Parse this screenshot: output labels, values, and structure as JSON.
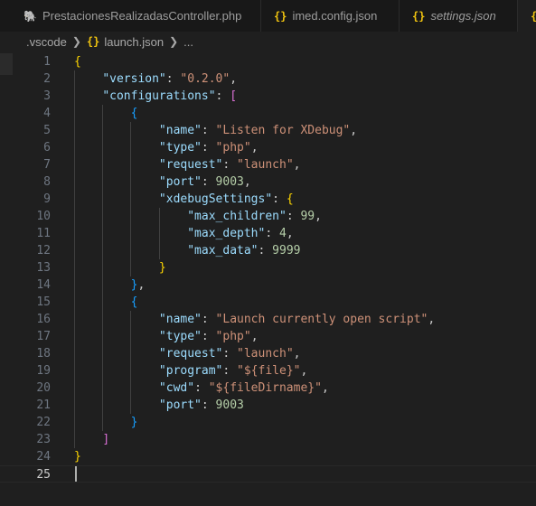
{
  "tabs": [
    {
      "icon": "php-icon",
      "glyph": "🐘",
      "label": "PrestacionesRealizadasController.php",
      "italic": false
    },
    {
      "icon": "json-icon",
      "glyph": "{}",
      "label": "imed.config.json",
      "italic": false
    },
    {
      "icon": "json-icon",
      "glyph": "{}",
      "label": "settings.json",
      "italic": true
    },
    {
      "icon": "json-icon",
      "glyph": "{",
      "label": "",
      "italic": false
    }
  ],
  "breadcrumb": {
    "folder": ".vscode",
    "file_icon": "{}",
    "file": "launch.json",
    "more": "..."
  },
  "editor": {
    "current_line": 25,
    "lines": [
      {
        "n": "1",
        "tokens": [
          [
            "{",
            "b1"
          ]
        ]
      },
      {
        "n": "2",
        "tokens": [
          [
            "    ",
            "t-pun"
          ],
          [
            "\"version\"",
            "t-key"
          ],
          [
            ": ",
            "t-pun"
          ],
          [
            "\"0.2.0\"",
            "t-str"
          ],
          [
            ",",
            "t-pun"
          ]
        ]
      },
      {
        "n": "3",
        "tokens": [
          [
            "    ",
            "t-pun"
          ],
          [
            "\"configurations\"",
            "t-key"
          ],
          [
            ": ",
            "t-pun"
          ],
          [
            "[",
            "b2"
          ]
        ]
      },
      {
        "n": "4",
        "tokens": [
          [
            "        ",
            "t-pun"
          ],
          [
            "{",
            "b3"
          ]
        ]
      },
      {
        "n": "5",
        "tokens": [
          [
            "            ",
            "t-pun"
          ],
          [
            "\"name\"",
            "t-key"
          ],
          [
            ": ",
            "t-pun"
          ],
          [
            "\"Listen for XDebug\"",
            "t-str"
          ],
          [
            ",",
            "t-pun"
          ]
        ]
      },
      {
        "n": "6",
        "tokens": [
          [
            "            ",
            "t-pun"
          ],
          [
            "\"type\"",
            "t-key"
          ],
          [
            ": ",
            "t-pun"
          ],
          [
            "\"php\"",
            "t-str"
          ],
          [
            ",",
            "t-pun"
          ]
        ]
      },
      {
        "n": "7",
        "tokens": [
          [
            "            ",
            "t-pun"
          ],
          [
            "\"request\"",
            "t-key"
          ],
          [
            ": ",
            "t-pun"
          ],
          [
            "\"launch\"",
            "t-str"
          ],
          [
            ",",
            "t-pun"
          ]
        ]
      },
      {
        "n": "8",
        "tokens": [
          [
            "            ",
            "t-pun"
          ],
          [
            "\"port\"",
            "t-key"
          ],
          [
            ": ",
            "t-pun"
          ],
          [
            "9003",
            "t-num"
          ],
          [
            ",",
            "t-pun"
          ]
        ]
      },
      {
        "n": "9",
        "tokens": [
          [
            "            ",
            "t-pun"
          ],
          [
            "\"xdebugSettings\"",
            "t-key"
          ],
          [
            ": ",
            "t-pun"
          ],
          [
            "{",
            "b1"
          ]
        ]
      },
      {
        "n": "10",
        "tokens": [
          [
            "                ",
            "t-pun"
          ],
          [
            "\"max_children\"",
            "t-key"
          ],
          [
            ": ",
            "t-pun"
          ],
          [
            "99",
            "t-num"
          ],
          [
            ",",
            "t-pun"
          ]
        ]
      },
      {
        "n": "11",
        "tokens": [
          [
            "                ",
            "t-pun"
          ],
          [
            "\"max_depth\"",
            "t-key"
          ],
          [
            ": ",
            "t-pun"
          ],
          [
            "4",
            "t-num"
          ],
          [
            ",",
            "t-pun"
          ]
        ]
      },
      {
        "n": "12",
        "tokens": [
          [
            "                ",
            "t-pun"
          ],
          [
            "\"max_data\"",
            "t-key"
          ],
          [
            ": ",
            "t-pun"
          ],
          [
            "9999",
            "t-num"
          ]
        ]
      },
      {
        "n": "13",
        "tokens": [
          [
            "            ",
            "t-pun"
          ],
          [
            "}",
            "b1"
          ]
        ]
      },
      {
        "n": "14",
        "tokens": [
          [
            "        ",
            "t-pun"
          ],
          [
            "}",
            "b3"
          ],
          [
            ",",
            "t-pun"
          ]
        ]
      },
      {
        "n": "15",
        "tokens": [
          [
            "        ",
            "t-pun"
          ],
          [
            "{",
            "b3"
          ]
        ]
      },
      {
        "n": "16",
        "tokens": [
          [
            "            ",
            "t-pun"
          ],
          [
            "\"name\"",
            "t-key"
          ],
          [
            ": ",
            "t-pun"
          ],
          [
            "\"Launch currently open script\"",
            "t-str"
          ],
          [
            ",",
            "t-pun"
          ]
        ]
      },
      {
        "n": "17",
        "tokens": [
          [
            "            ",
            "t-pun"
          ],
          [
            "\"type\"",
            "t-key"
          ],
          [
            ": ",
            "t-pun"
          ],
          [
            "\"php\"",
            "t-str"
          ],
          [
            ",",
            "t-pun"
          ]
        ]
      },
      {
        "n": "18",
        "tokens": [
          [
            "            ",
            "t-pun"
          ],
          [
            "\"request\"",
            "t-key"
          ],
          [
            ": ",
            "t-pun"
          ],
          [
            "\"launch\"",
            "t-str"
          ],
          [
            ",",
            "t-pun"
          ]
        ]
      },
      {
        "n": "19",
        "tokens": [
          [
            "            ",
            "t-pun"
          ],
          [
            "\"program\"",
            "t-key"
          ],
          [
            ": ",
            "t-pun"
          ],
          [
            "\"${file}\"",
            "t-str"
          ],
          [
            ",",
            "t-pun"
          ]
        ]
      },
      {
        "n": "20",
        "tokens": [
          [
            "            ",
            "t-pun"
          ],
          [
            "\"cwd\"",
            "t-key"
          ],
          [
            ": ",
            "t-pun"
          ],
          [
            "\"${fileDirname}\"",
            "t-str"
          ],
          [
            ",",
            "t-pun"
          ]
        ]
      },
      {
        "n": "21",
        "tokens": [
          [
            "            ",
            "t-pun"
          ],
          [
            "\"port\"",
            "t-key"
          ],
          [
            ": ",
            "t-pun"
          ],
          [
            "9003",
            "t-num"
          ]
        ]
      },
      {
        "n": "22",
        "tokens": [
          [
            "        ",
            "t-pun"
          ],
          [
            "}",
            "b3"
          ]
        ]
      },
      {
        "n": "23",
        "tokens": [
          [
            "    ",
            "t-pun"
          ],
          [
            "]",
            "b2"
          ]
        ]
      },
      {
        "n": "24",
        "tokens": [
          [
            "}",
            "b1"
          ]
        ]
      },
      {
        "n": "25",
        "tokens": []
      }
    ]
  },
  "colors": {
    "editor_bg": "#1f1f1f",
    "key": "#9cdcfe",
    "string": "#ce9178",
    "number": "#b5cea8",
    "bracket_level1": "#ffd700",
    "bracket_level2": "#da70d6",
    "bracket_level3": "#179fff"
  }
}
